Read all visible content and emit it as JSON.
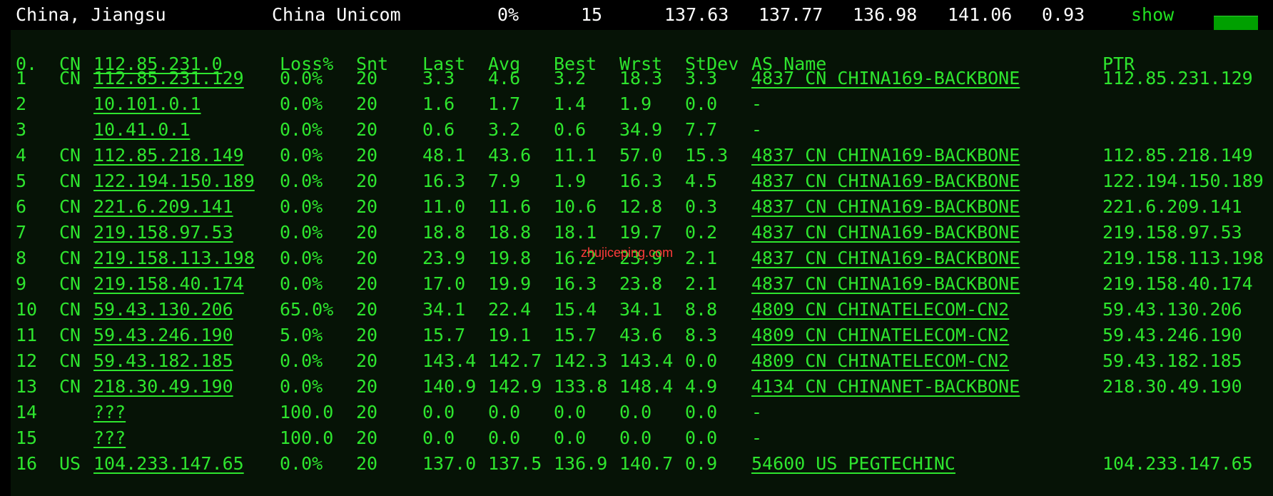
{
  "summary": {
    "location": "China, Jiangsu",
    "isp": "China Unicom",
    "loss": "0%",
    "hops": "15",
    "last": "137.63",
    "avg": "137.77",
    "best": "136.98",
    "worst": "141.06",
    "stdev": "0.93",
    "show_label": "show"
  },
  "table": {
    "header": {
      "hop": "0.",
      "cc": "CN",
      "host": "112.85.231.0",
      "loss": "Loss%",
      "snt": "Snt",
      "last": "Last",
      "avg": "Avg",
      "best": "Best",
      "wrst": "Wrst",
      "stdev": "StDev",
      "as_name": "AS Name",
      "ptr": "PTR"
    },
    "rows": [
      {
        "hop": "1",
        "cc": "CN",
        "host": "112.85.231.129",
        "loss": "0.0%",
        "snt": "20",
        "last": "3.3",
        "avg": "4.6",
        "best": "3.2",
        "wrst": "18.3",
        "stdev": "3.3",
        "as_name": "4837  CN CHINA169-BACKBONE",
        "ptr": "112.85.231.129"
      },
      {
        "hop": "2",
        "cc": "",
        "host": "10.101.0.1",
        "loss": "0.0%",
        "snt": "20",
        "last": "1.6",
        "avg": "1.7",
        "best": "1.4",
        "wrst": "1.9",
        "stdev": "0.0",
        "as_name": "-",
        "ptr": ""
      },
      {
        "hop": "3",
        "cc": "",
        "host": "10.41.0.1",
        "loss": "0.0%",
        "snt": "20",
        "last": "0.6",
        "avg": "3.2",
        "best": "0.6",
        "wrst": "34.9",
        "stdev": "7.7",
        "as_name": "-",
        "ptr": ""
      },
      {
        "hop": "4",
        "cc": "CN",
        "host": "112.85.218.149",
        "loss": "0.0%",
        "snt": "20",
        "last": "48.1",
        "avg": "43.6",
        "best": "11.1",
        "wrst": "57.0",
        "stdev": "15.3",
        "as_name": "4837  CN CHINA169-BACKBONE",
        "ptr": "112.85.218.149"
      },
      {
        "hop": "5",
        "cc": "CN",
        "host": "122.194.150.189",
        "loss": "0.0%",
        "snt": "20",
        "last": "16.3",
        "avg": "7.9",
        "best": "1.9",
        "wrst": "16.3",
        "stdev": "4.5",
        "as_name": "4837  CN CHINA169-BACKBONE",
        "ptr": "122.194.150.189"
      },
      {
        "hop": "6",
        "cc": "CN",
        "host": "221.6.209.141",
        "loss": "0.0%",
        "snt": "20",
        "last": "11.0",
        "avg": "11.6",
        "best": "10.6",
        "wrst": "12.8",
        "stdev": "0.3",
        "as_name": "4837  CN CHINA169-BACKBONE",
        "ptr": "221.6.209.141"
      },
      {
        "hop": "7",
        "cc": "CN",
        "host": "219.158.97.53",
        "loss": "0.0%",
        "snt": "20",
        "last": "18.8",
        "avg": "18.8",
        "best": "18.1",
        "wrst": "19.7",
        "stdev": "0.2",
        "as_name": "4837  CN CHINA169-BACKBONE",
        "ptr": "219.158.97.53"
      },
      {
        "hop": "8",
        "cc": "CN",
        "host": "219.158.113.198",
        "loss": "0.0%",
        "snt": "20",
        "last": "23.9",
        "avg": "19.8",
        "best": "16.2",
        "wrst": "23.9",
        "stdev": "2.1",
        "as_name": "4837  CN CHINA169-BACKBONE",
        "ptr": "219.158.113.198"
      },
      {
        "hop": "9",
        "cc": "CN",
        "host": "219.158.40.174",
        "loss": "0.0%",
        "snt": "20",
        "last": "17.0",
        "avg": "19.9",
        "best": "16.3",
        "wrst": "23.8",
        "stdev": "2.1",
        "as_name": "4837  CN CHINA169-BACKBONE",
        "ptr": "219.158.40.174"
      },
      {
        "hop": "10",
        "cc": "CN",
        "host": "59.43.130.206",
        "loss": "65.0%",
        "snt": "20",
        "last": "34.1",
        "avg": "22.4",
        "best": "15.4",
        "wrst": "34.1",
        "stdev": "8.8",
        "as_name": "4809  CN CHINATELECOM-CN2",
        "ptr": "59.43.130.206"
      },
      {
        "hop": "11",
        "cc": "CN",
        "host": "59.43.246.190",
        "loss": "5.0%",
        "snt": "20",
        "last": "15.7",
        "avg": "19.1",
        "best": "15.7",
        "wrst": "43.6",
        "stdev": "8.3",
        "as_name": "4809  CN CHINATELECOM-CN2",
        "ptr": "59.43.246.190"
      },
      {
        "hop": "12",
        "cc": "CN",
        "host": "59.43.182.185",
        "loss": "0.0%",
        "snt": "20",
        "last": "143.4",
        "avg": "142.7",
        "best": "142.3",
        "wrst": "143.4",
        "stdev": "0.0",
        "as_name": "4809  CN CHINATELECOM-CN2",
        "ptr": "59.43.182.185"
      },
      {
        "hop": "13",
        "cc": "CN",
        "host": "218.30.49.190",
        "loss": "0.0%",
        "snt": "20",
        "last": "140.9",
        "avg": "142.9",
        "best": "133.8",
        "wrst": "148.4",
        "stdev": "4.9",
        "as_name": "4134  CN CHINANET-BACKBONE",
        "ptr": "218.30.49.190"
      },
      {
        "hop": "14",
        "cc": "",
        "host": "???",
        "loss": "100.0",
        "snt": "20",
        "last": "0.0",
        "avg": "0.0",
        "best": "0.0",
        "wrst": "0.0",
        "stdev": "0.0",
        "as_name": "-",
        "ptr": ""
      },
      {
        "hop": "15",
        "cc": "",
        "host": "???",
        "loss": "100.0",
        "snt": "20",
        "last": "0.0",
        "avg": "0.0",
        "best": "0.0",
        "wrst": "0.0",
        "stdev": "0.0",
        "as_name": "-",
        "ptr": ""
      },
      {
        "hop": "16",
        "cc": "US",
        "host": "104.233.147.65",
        "loss": "0.0%",
        "snt": "20",
        "last": "137.0",
        "avg": "137.5",
        "best": "136.9",
        "wrst": "140.7",
        "stdev": "0.9",
        "as_name": "54600 US PEGTECHINC",
        "ptr": "104.233.147.65"
      }
    ]
  },
  "watermark": "zhujiceping.com",
  "colors": {
    "terminal_green": "#2ee52e",
    "panel_background": "#061306",
    "summary_text": "#ffffff",
    "watermark": "#ff3b3b"
  }
}
